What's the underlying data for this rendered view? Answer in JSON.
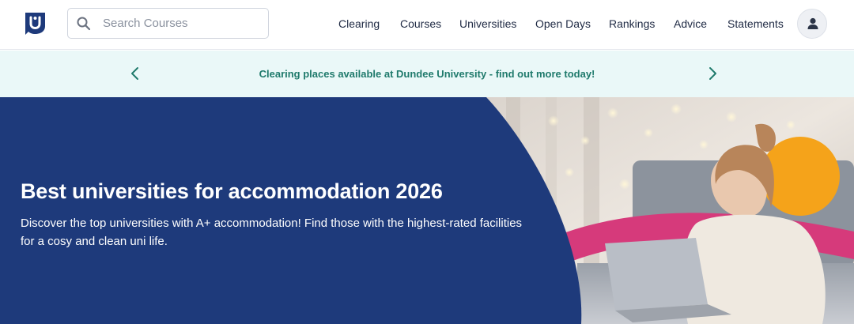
{
  "header": {
    "logo_name": "logo-icon",
    "search": {
      "placeholder": "Search Courses",
      "value": ""
    },
    "nav": [
      {
        "label": "Clearing"
      },
      {
        "label": "Courses"
      },
      {
        "label": "Universities"
      },
      {
        "label": "Open Days"
      },
      {
        "label": "Rankings"
      },
      {
        "label": "Advice"
      },
      {
        "label": "Statements"
      }
    ]
  },
  "banner": {
    "text": "Clearing places available at Dundee University - find out more today!"
  },
  "hero": {
    "title": "Best universities for accommodation 2026",
    "description": "Discover the top universities with A+ accommodation! Find those with the highest-rated facilities for a cosy and clean uni life."
  },
  "colors": {
    "brand_blue": "#1e3a7b",
    "banner_bg": "#eaf8f8",
    "banner_text": "#1f7a6c",
    "accent_pink": "#d63a7b",
    "accent_orange": "#f5a31a"
  }
}
